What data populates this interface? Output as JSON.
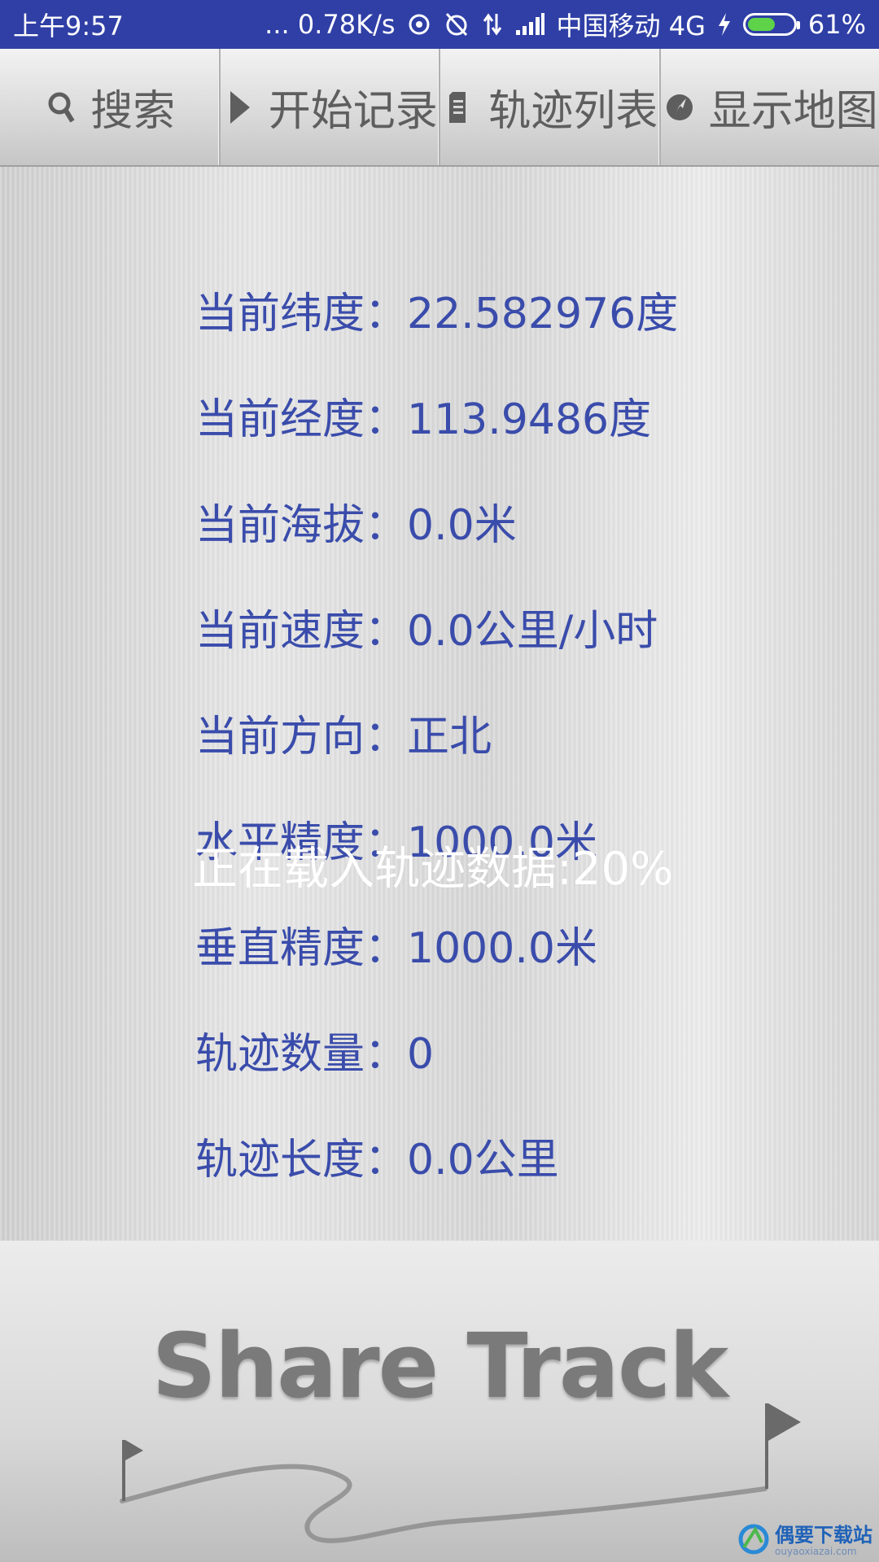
{
  "status_bar": {
    "time": "上午9:57",
    "net_speed": "... 0.78K/s",
    "carrier": "中国移动 4G",
    "battery": "61%",
    "battery_level": 0.61
  },
  "toolbar": {
    "search_label": "搜索",
    "record_label": "开始记录",
    "tracks_label": "轨迹列表",
    "map_label": "显示地图"
  },
  "info": {
    "latitude": "当前纬度：22.582976度",
    "longitude": "当前经度：113.9486度",
    "altitude": "当前海拔：0.0米",
    "speed": "当前速度：0.0公里/小时",
    "direction": "当前方向：正北",
    "h_accuracy": "水平精度：1000.0米",
    "v_accuracy": "垂直精度：1000.0米",
    "track_count": "轨迹数量：0",
    "track_length": "轨迹长度：0.0公里"
  },
  "loading_message": "正在载入轨迹数据:20%",
  "banner": {
    "brand": "Share Track"
  },
  "watermark": {
    "name": "偶要下载站",
    "url": "ouyaoxiazai.com"
  },
  "colors": {
    "status_bar": "#2f3fa6",
    "info_text": "#3a4cab",
    "toolbar_text": "#5e5e5e"
  }
}
